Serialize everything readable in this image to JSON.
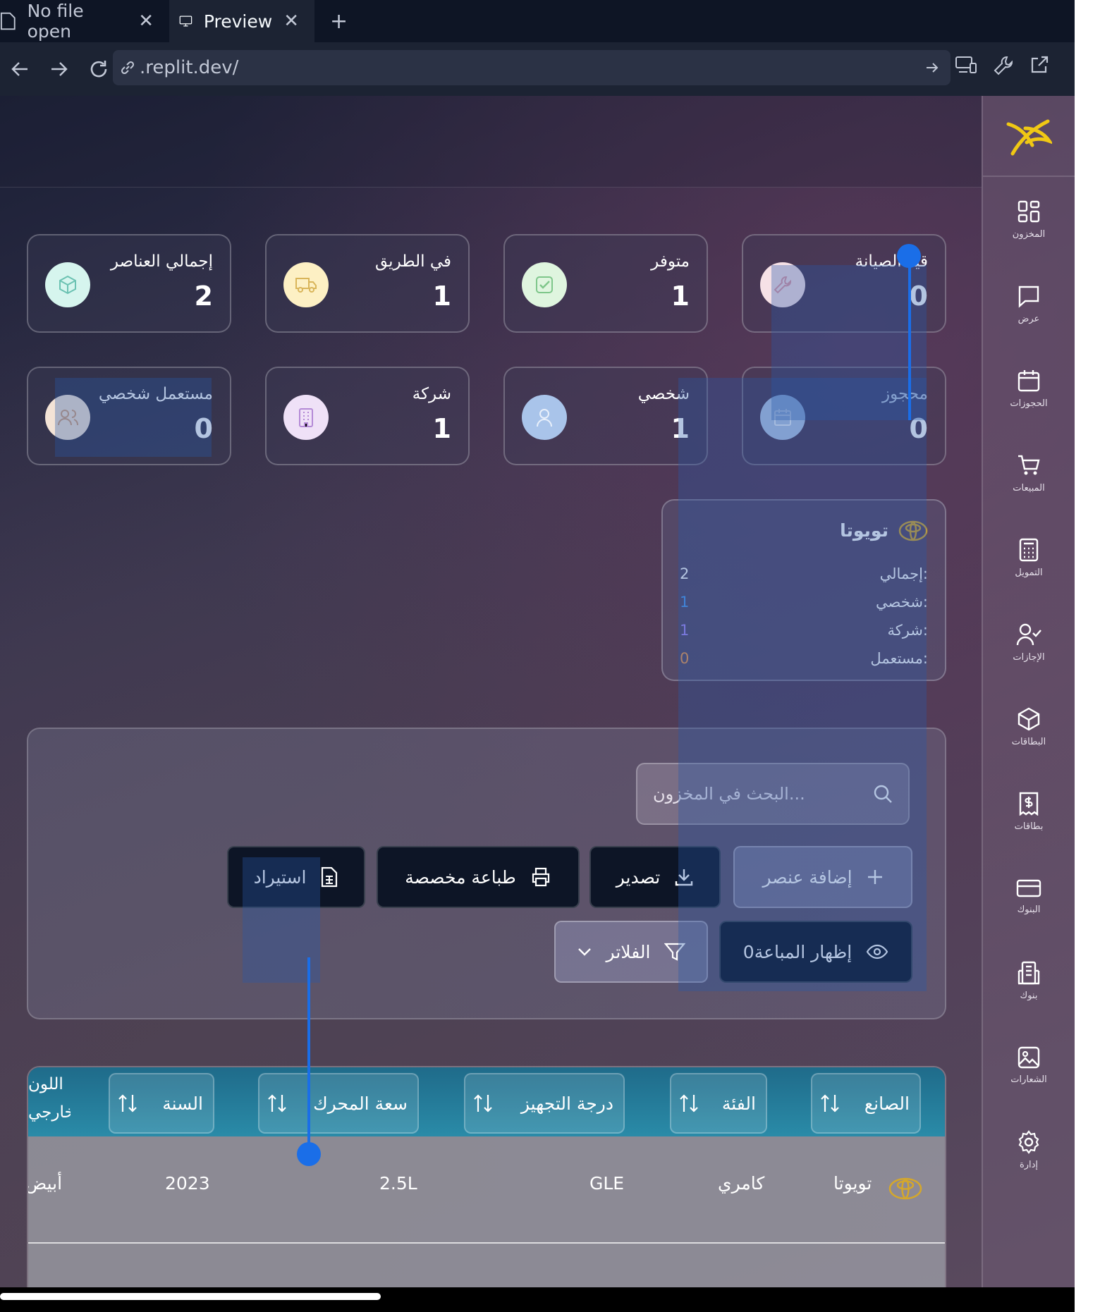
{
  "browser": {
    "tabs": [
      {
        "label": "No file open",
        "icon": "file-icon"
      },
      {
        "label": "Preview",
        "icon": "monitor-icon"
      }
    ],
    "url": ".replit.dev/"
  },
  "sidebar": {
    "items": [
      {
        "label": "المخزون",
        "icon": "grid-icon"
      },
      {
        "label": "عرض",
        "icon": "chat-icon"
      },
      {
        "label": "الحجوزات",
        "icon": "calendar-icon"
      },
      {
        "label": "المبيعات",
        "icon": "cart-icon"
      },
      {
        "label": "التمويل",
        "icon": "calculator-icon"
      },
      {
        "label": "الإجازات",
        "icon": "user-check-icon"
      },
      {
        "label": "البطاقات",
        "icon": "box-icon"
      },
      {
        "label": "بطاقات",
        "icon": "receipt-icon"
      },
      {
        "label": "البنوك",
        "icon": "card-icon"
      },
      {
        "label": "بنوك",
        "icon": "building-icon"
      },
      {
        "label": "الشعارات",
        "icon": "image-icon"
      },
      {
        "label": "إدارة",
        "icon": "gear-icon"
      }
    ]
  },
  "stats": [
    {
      "title": "إجمالي العناصر",
      "value": "2",
      "icon": "package-icon",
      "color": "#d6f5ee"
    },
    {
      "title": "في الطريق",
      "value": "1",
      "icon": "truck-icon",
      "color": "#fdf0c4"
    },
    {
      "title": "متوفر",
      "value": "1",
      "icon": "check-icon",
      "color": "#dff5df"
    },
    {
      "title": "قيد الصيانة",
      "value": "0",
      "icon": "wrench-icon",
      "color": "#f6e1e6"
    },
    {
      "title": "مستعمل شخصي",
      "value": "0",
      "icon": "users-icon",
      "color": "#f3e3d6"
    },
    {
      "title": "شركة",
      "value": "1",
      "icon": "building-icon",
      "color": "#efe1f7"
    },
    {
      "title": "شخصي",
      "value": "1",
      "icon": "user-icon",
      "color": "#c9dcf5"
    },
    {
      "title": "محجوز",
      "value": "0",
      "icon": "calendar-icon",
      "color": "#cddaf0"
    }
  ],
  "brand_card": {
    "name": "تويوتا",
    "rows": [
      {
        "label": "إجمالي:",
        "value": "2",
        "color": "#ffffff"
      },
      {
        "label": "شخصي:",
        "value": "1",
        "color": "#4e9cf2"
      },
      {
        "label": "شركة:",
        "value": "1",
        "color": "#a78bfa"
      },
      {
        "label": "مستعمل:",
        "value": "0",
        "color": "#f2994a"
      }
    ]
  },
  "toolbar": {
    "search_placeholder": "البحث في المخزون...",
    "add_label": "إضافة عنصر",
    "export_label": "تصدير",
    "print_label": "طباعة مخصصة",
    "import_label": "استيراد",
    "show_sold_label": "إظهار المباعة0",
    "filters_label": "الفلاتر"
  },
  "table": {
    "headers": [
      "الصانع",
      "الفئة",
      "درجة التجهيز",
      "سعة المحرك",
      "السنة",
      "اللون الخارجي"
    ],
    "rows": [
      {
        "maker": "تويوتا",
        "category": "كامري",
        "trim": "GLE",
        "engine": "2.5L",
        "year": "2023",
        "color": "أبيض"
      }
    ]
  },
  "colors": {
    "accent": "#1a6ee8",
    "brand_gold": "#d4a72c"
  }
}
